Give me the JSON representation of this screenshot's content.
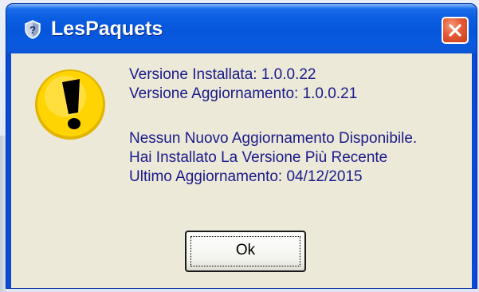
{
  "window": {
    "title": "LesPaquets"
  },
  "message": {
    "installed_version": "Versione Installata: 1.0.0.22",
    "update_version": "Versione Aggiornamento: 1.0.0.21",
    "no_update": "Nessun Nuovo Aggiornamento Disponibile.",
    "latest_installed": "Hai Installato La Versione Più Recente",
    "last_update": "Ultimo Aggiornamento: 04/12/2015"
  },
  "buttons": {
    "ok_label": "Ok"
  },
  "icons": {
    "title": "shield-question-icon",
    "dialog": "warning-exclamation-icon",
    "close": "close-icon"
  },
  "colors": {
    "titlebar": "#0a5de0",
    "client_background": "#ece9d8",
    "close_button": "#e45a34",
    "message_text": "#1a1a8a",
    "warning_yellow": "#ffd400"
  }
}
